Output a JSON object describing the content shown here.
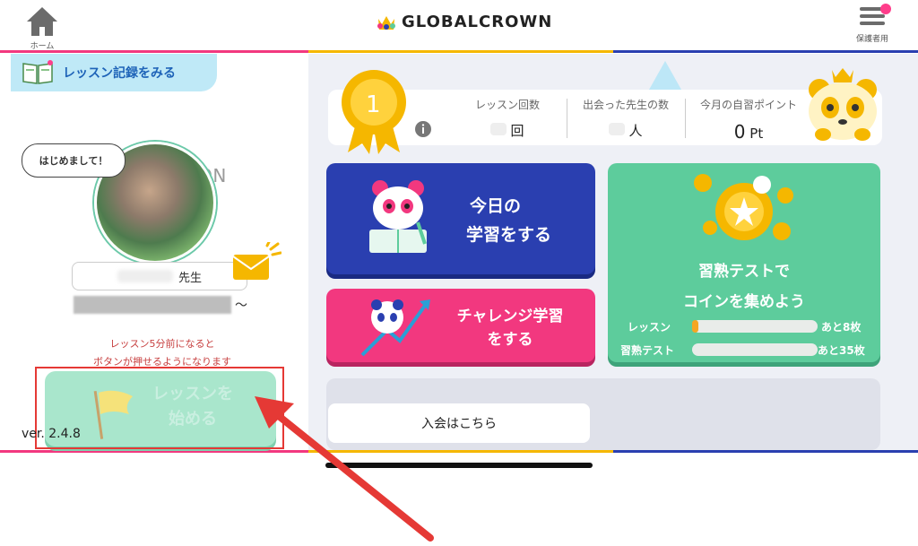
{
  "header": {
    "home_label": "ホーム",
    "logo_text": "GLOBALCROWN",
    "parent_label": "保護者用"
  },
  "left": {
    "record_button": "レッスン記録をみる",
    "next_lesson": "NEXT LESSON",
    "greeting": "はじめまして！",
    "teacher_suffix": "先生",
    "tilde": "〜",
    "notice_line1": "レッスン5分前になると",
    "notice_line2": "ボタンが押せるようになります",
    "start_button_line1": "レッスンを",
    "start_button_line2": "始める",
    "version": "ver. 2.4.8"
  },
  "stats": {
    "rank": "1",
    "lesson_count_label": "レッスン回数",
    "lesson_count_unit": "回",
    "teachers_met_label": "出会った先生の数",
    "teachers_met_unit": "人",
    "points_label": "今月の自習ポイント",
    "points_value": "0",
    "points_unit": "Pt"
  },
  "cards": {
    "study_line1": "今日の",
    "study_line2": "学習をする",
    "challenge_line1": "チャレンジ学習",
    "challenge_line2": "をする",
    "coin_line1": "習熟テストで",
    "coin_line2": "コインを集めよう",
    "lesson_label": "レッスン",
    "lesson_remaining": "あと8枚",
    "test_label": "習熟テスト",
    "test_remaining": "あと35枚",
    "lesson_progress": 0.05,
    "test_progress": 0
  },
  "join": {
    "button": "入会はこちら"
  },
  "colors": {
    "pink": "#f2387f",
    "blue": "#2a3fb0",
    "green": "#5dcc9c",
    "yellow": "#f5b700",
    "accent_red": "#e53935"
  }
}
